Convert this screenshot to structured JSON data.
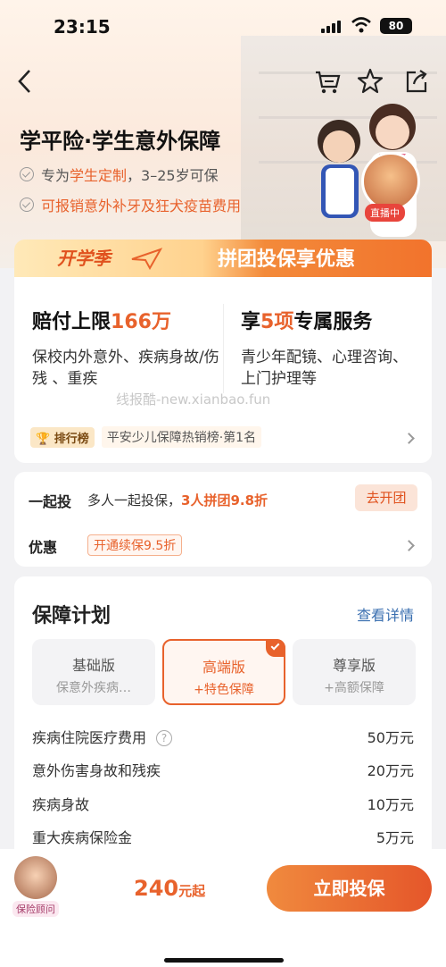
{
  "status": {
    "time": "23:15",
    "battery": "80"
  },
  "header": {
    "title": "学平险·学生意外保障",
    "features": [
      {
        "prefix": "专为",
        "highlight": "学生定制",
        "suffix": "，3–25岁可保"
      },
      {
        "text": "可报销意外补牙及狂犬疫苗费用"
      }
    ],
    "live_tag": "直播中"
  },
  "banner": {
    "left": "开学季",
    "right": "拼团投保享优惠"
  },
  "summary": {
    "left_title_prefix": "赔付上限",
    "left_title_highlight": "166万",
    "left_desc": "保校内外意外、疾病身故/伤残 、重疾",
    "right_title_prefix": "享",
    "right_title_highlight": "5项",
    "right_title_suffix": "专属服务",
    "right_desc": "青少年配镜、心理咨询、上门护理等",
    "watermark": "线报酷-new.xianbao.fun",
    "rank_badge": "排行榜",
    "rank_text": "平安少儿保障热销榜·第1名"
  },
  "group": {
    "label": "一起投",
    "desc_prefix": "多人一起投保，",
    "desc_highlight": "3人拼团9.8折",
    "button": "去开团",
    "discount_label": "优惠",
    "discount_tag": "开通续保9.5折"
  },
  "plans": {
    "title": "保障计划",
    "details_link": "查看详情",
    "options": [
      {
        "name": "基础版",
        "desc": "保意外疾病…"
      },
      {
        "name": "高端版",
        "desc": "+特色保障",
        "selected": true
      },
      {
        "name": "尊享版",
        "desc": "+高额保障"
      }
    ],
    "coverage": [
      {
        "label": "疾病住院医疗费用",
        "value": "50万元",
        "help": "?"
      },
      {
        "label": "意外伤害身故和残疾",
        "value": "20万元"
      },
      {
        "label": "疾病身故",
        "value": "10万元"
      },
      {
        "label": "重大疾病保险金",
        "value": "5万元"
      }
    ]
  },
  "footer": {
    "advisor_label": "保险顾问",
    "price": "240",
    "price_unit": "元起",
    "buy_button": "立即投保"
  },
  "colors": {
    "accent": "#e8622c",
    "button_start": "#f08a3e",
    "button_end": "#e5562a"
  }
}
